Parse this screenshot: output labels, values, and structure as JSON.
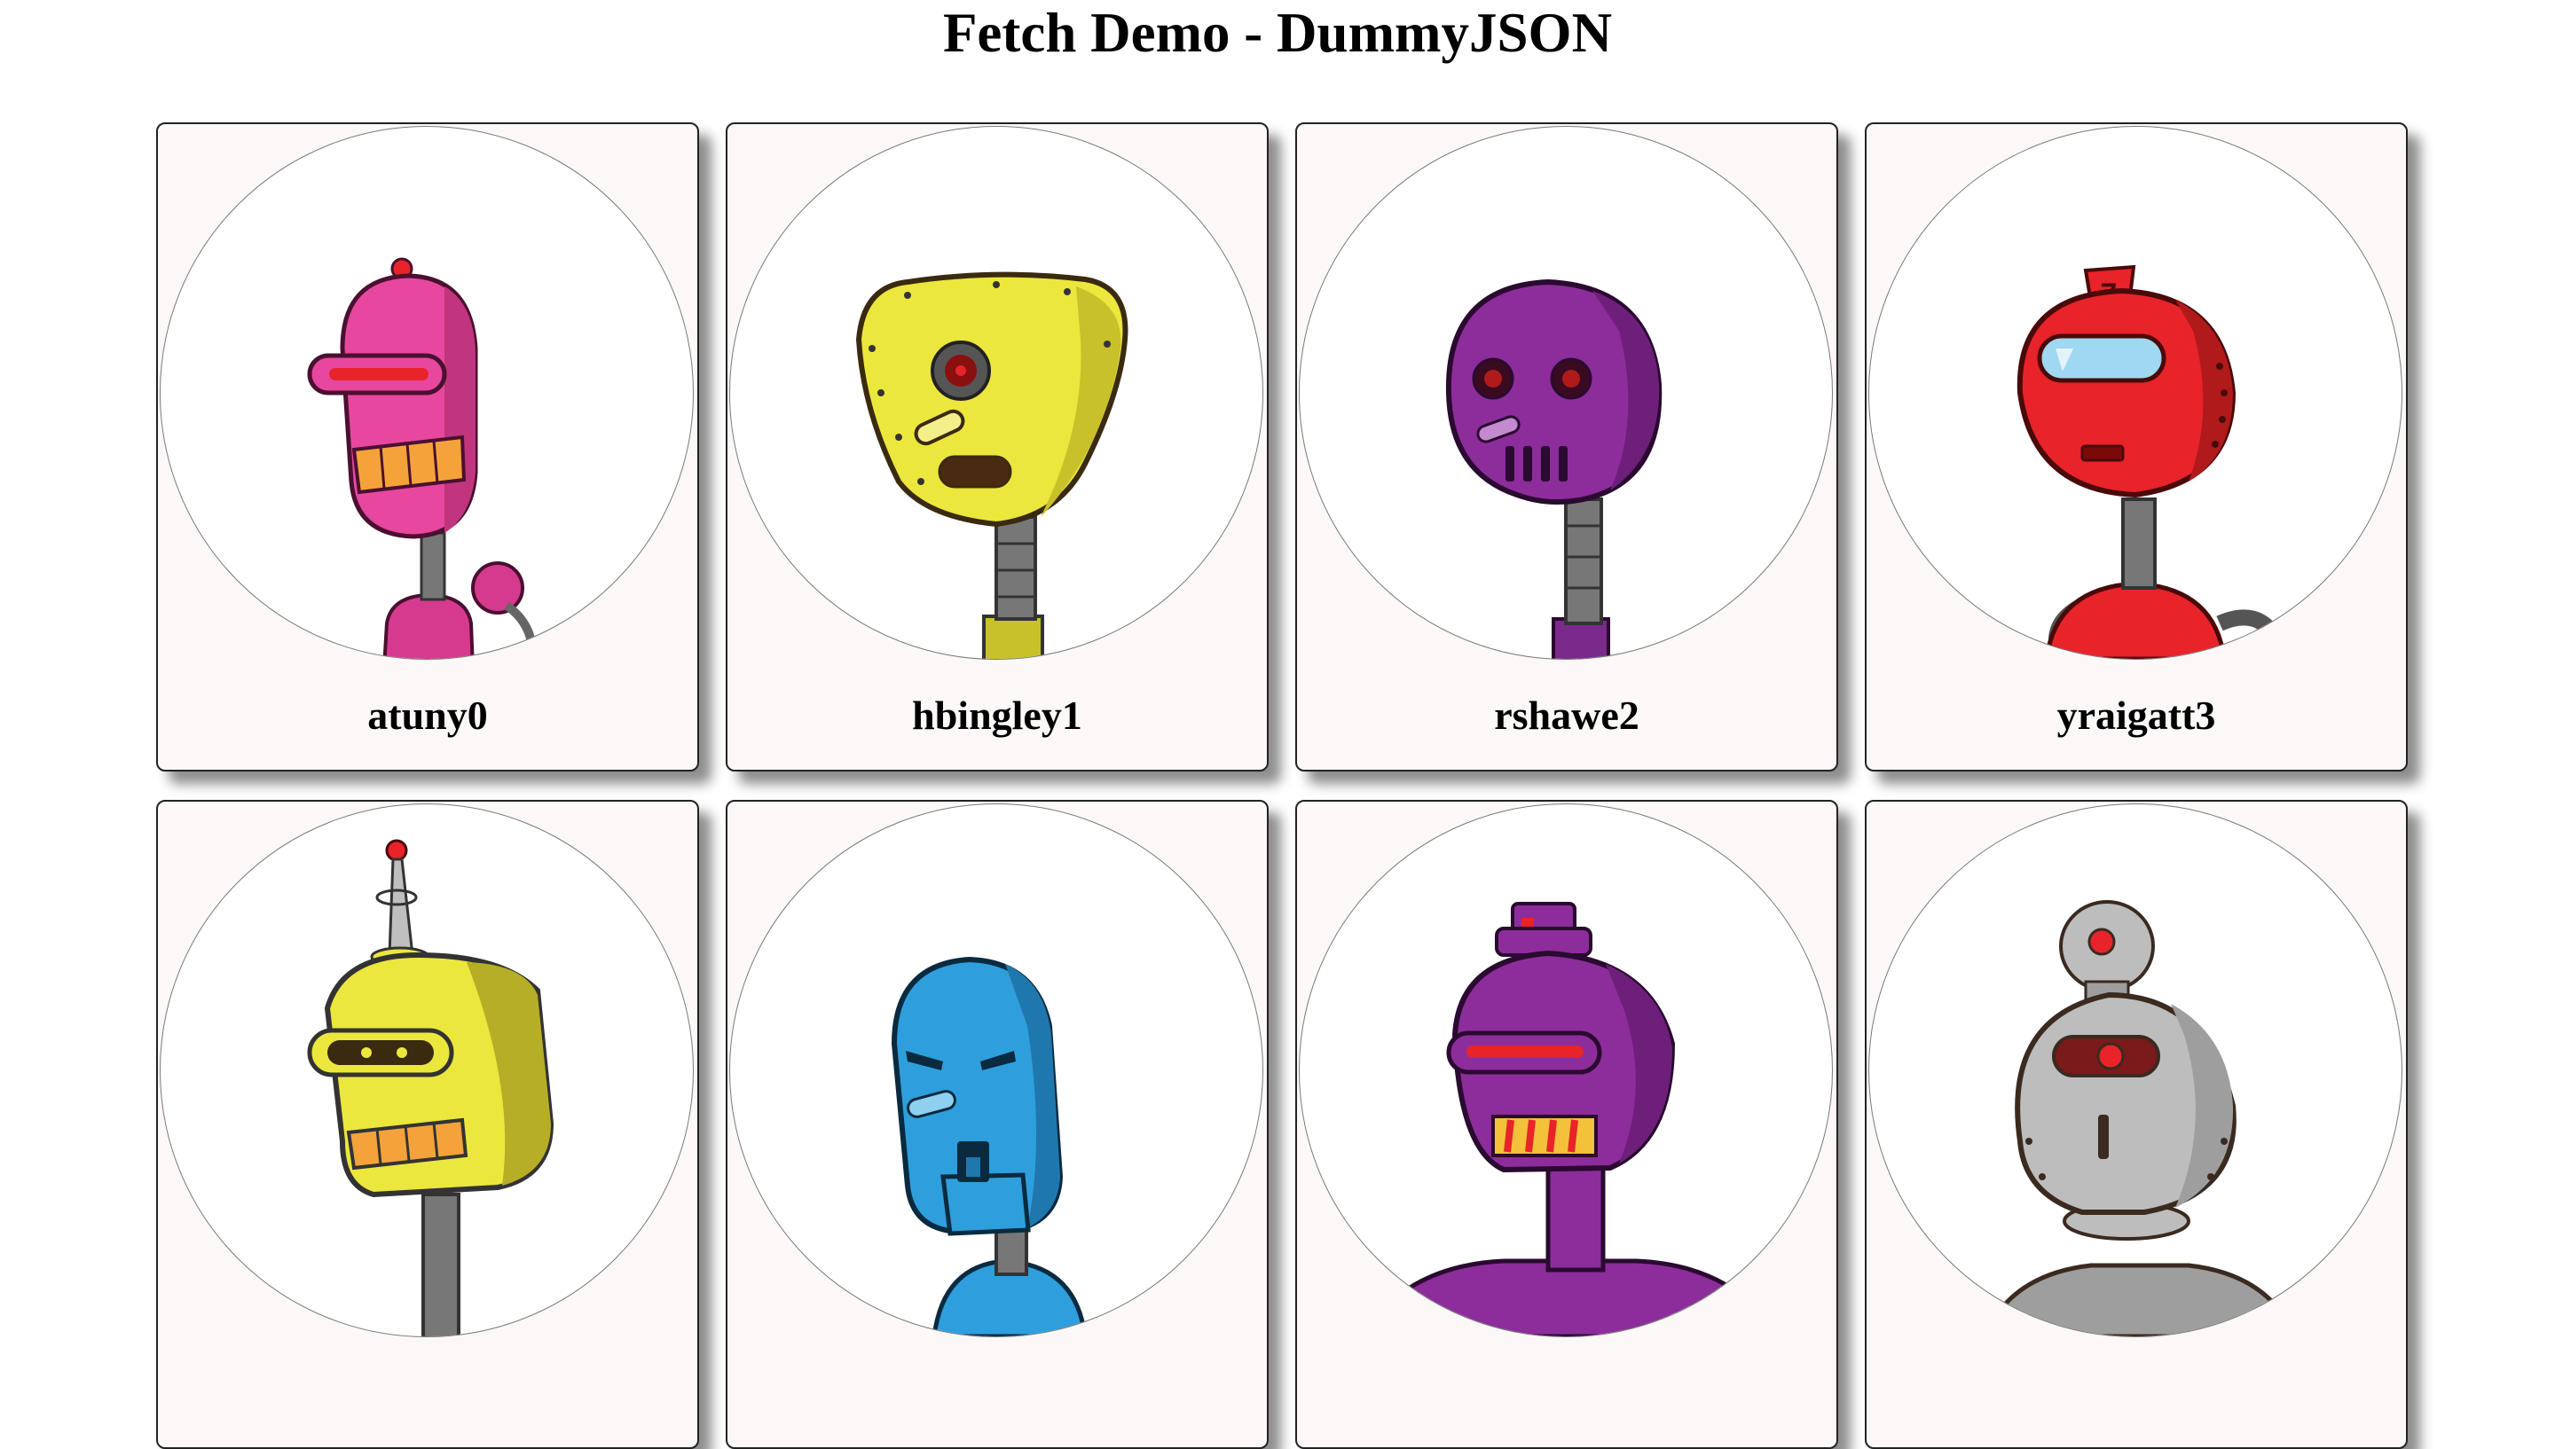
{
  "page": {
    "title": "Fetch Demo - DummyJSON"
  },
  "users": [
    {
      "username": "atuny0",
      "avatar_icon": "pink-robot-icon",
      "color": "#e8479f"
    },
    {
      "username": "hbingley1",
      "avatar_icon": "yellow-robot-icon",
      "color": "#ece73c"
    },
    {
      "username": "rshawe2",
      "avatar_icon": "purple-robot-icon",
      "color": "#8d2d9b"
    },
    {
      "username": "yraigatt3",
      "avatar_icon": "red-robot-icon",
      "color": "#e8232a"
    },
    {
      "username": "",
      "avatar_icon": "yellow-antenna-robot-icon",
      "color": "#ece73c"
    },
    {
      "username": "",
      "avatar_icon": "blue-robot-icon",
      "color": "#2e9fdc"
    },
    {
      "username": "",
      "avatar_icon": "purple-hat-robot-icon",
      "color": "#8d2d9b"
    },
    {
      "username": "",
      "avatar_icon": "gray-robot-icon",
      "color": "#9e9e9e"
    }
  ]
}
